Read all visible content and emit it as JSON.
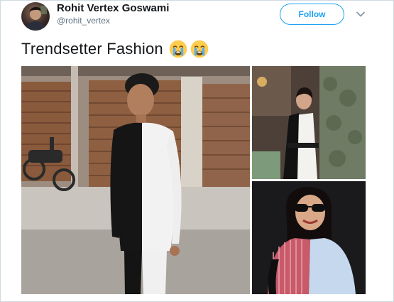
{
  "author": {
    "name": "Rohit Vertex Goswami",
    "handle": "@rohit_vertex"
  },
  "follow_button_label": "Follow",
  "tweet_text": "Trendsetter Fashion",
  "emojis": [
    "crying-face-emoji",
    "crying-face-emoji"
  ],
  "icons": {
    "menu": "chevron-down-icon"
  },
  "photos": [
    {
      "name": "photo-man-half-black-half-white-outfit"
    },
    {
      "name": "photo-woman-black-white-dress"
    },
    {
      "name": "photo-woman-half-pink-half-blue-shirt"
    }
  ],
  "colors": {
    "accent": "#1da1f2",
    "text": "#14171a",
    "muted": "#657786"
  }
}
